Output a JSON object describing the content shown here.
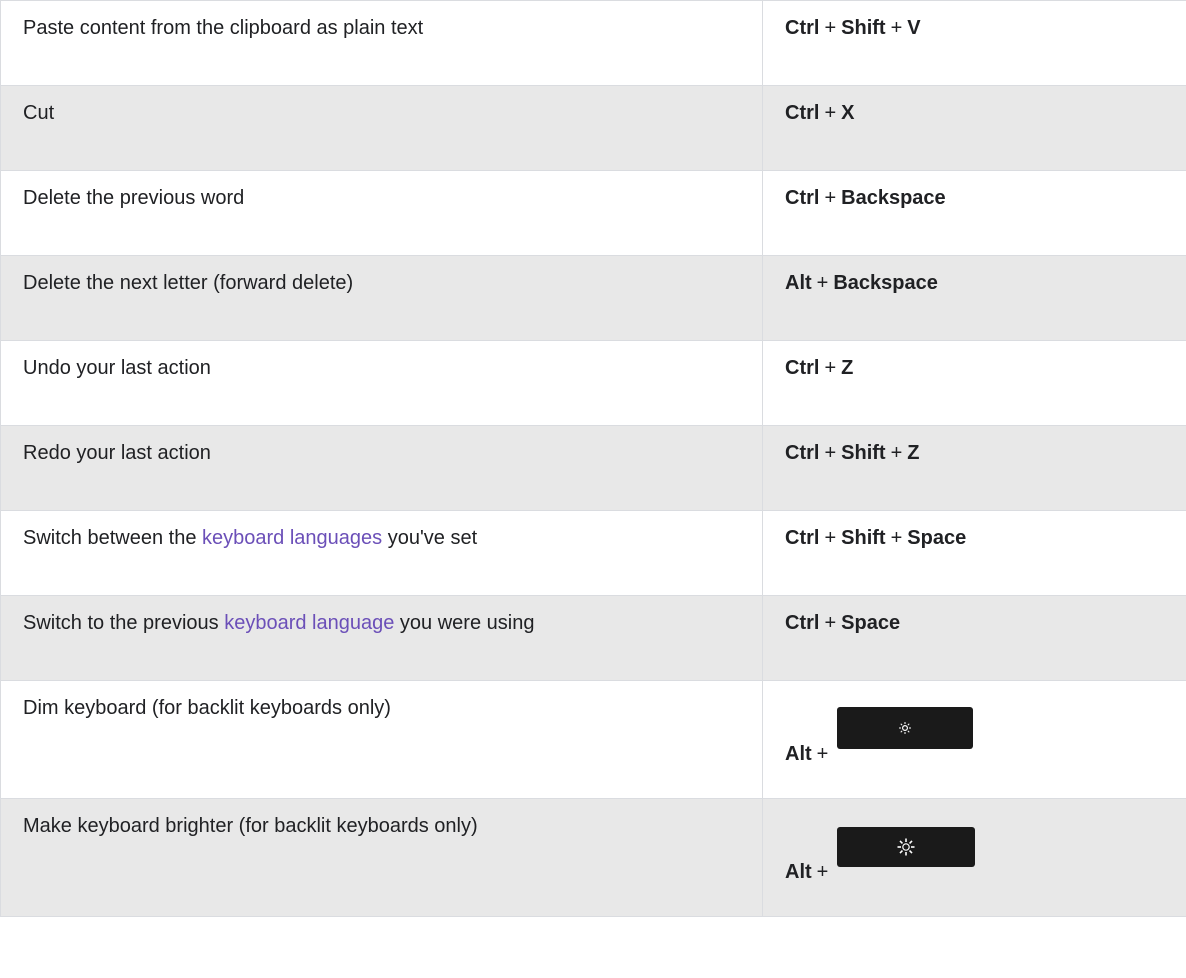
{
  "rows": [
    {
      "action_parts": [
        {
          "text": "Paste content from the clipboard as plain text",
          "link": false
        }
      ],
      "keys": [
        "Ctrl",
        "Shift",
        "V"
      ]
    },
    {
      "action_parts": [
        {
          "text": "Cut",
          "link": false
        }
      ],
      "keys": [
        "Ctrl",
        "X"
      ]
    },
    {
      "action_parts": [
        {
          "text": "Delete the previous word",
          "link": false
        }
      ],
      "keys": [
        "Ctrl",
        "Backspace"
      ]
    },
    {
      "action_parts": [
        {
          "text": "Delete the next letter (forward delete)",
          "link": false
        }
      ],
      "keys": [
        "Alt",
        "Backspace"
      ]
    },
    {
      "action_parts": [
        {
          "text": "Undo your last action",
          "link": false
        }
      ],
      "keys": [
        "Ctrl",
        "Z"
      ]
    },
    {
      "action_parts": [
        {
          "text": "Redo your last action",
          "link": false
        }
      ],
      "keys": [
        "Ctrl",
        "Shift",
        "Z"
      ]
    },
    {
      "action_parts": [
        {
          "text": "Switch between the ",
          "link": false
        },
        {
          "text": "keyboard languages",
          "link": true
        },
        {
          "text": " you've set",
          "link": false
        }
      ],
      "keys": [
        "Ctrl",
        "Shift",
        "Space"
      ]
    },
    {
      "action_parts": [
        {
          "text": "Switch to the previous ",
          "link": false
        },
        {
          "text": "keyboard language",
          "link": true
        },
        {
          "text": " you were using",
          "link": false
        }
      ],
      "keys": [
        "Ctrl",
        "Space"
      ]
    },
    {
      "action_parts": [
        {
          "text": "Dim keyboard (for backlit keyboards only)",
          "link": false
        }
      ],
      "keys": [
        "Alt"
      ],
      "key_icon": "brightness-down-key-icon"
    },
    {
      "action_parts": [
        {
          "text": "Make keyboard brighter (for backlit keyboards only)",
          "link": false
        }
      ],
      "keys": [
        "Alt"
      ],
      "key_icon": "brightness-up-key-icon"
    }
  ],
  "plus_sign": "+",
  "colors": {
    "link": "#6b4fb8",
    "row_alt_bg": "#e8e8e8",
    "border": "#dadce0"
  }
}
